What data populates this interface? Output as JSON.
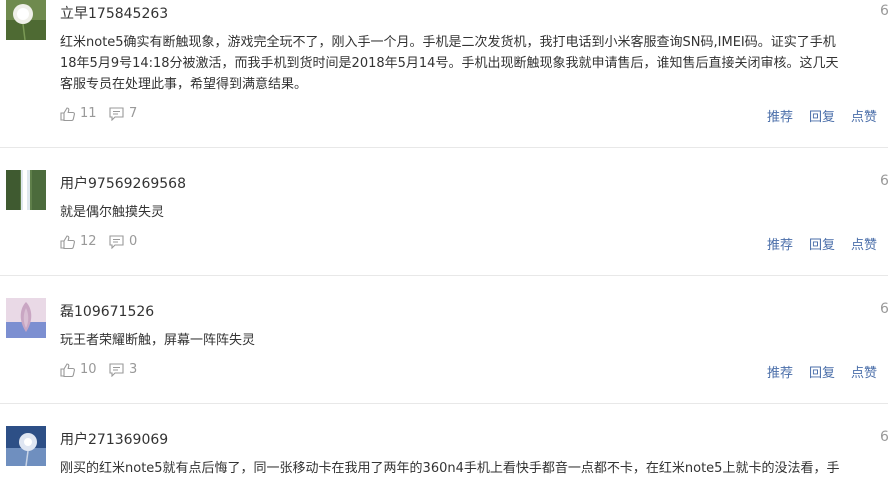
{
  "comments": [
    {
      "username": "立早175845263",
      "time": "6",
      "lines": [
        "红米note5确实有断触现象，游戏完全玩不了，刚入手一个月。手机是二次发货机，我打电话到小米客服查询SN码,IMEI码。证实了手机",
        "18年5月9号14:18分被激活，而我手机到货时间是2018年5月14号。手机出现断触现象我就申请售后，谁知售后直接关闭审核。这几天",
        "客服专员在处理此事，希望得到满意结果。"
      ],
      "likes": "11",
      "replies": "7",
      "avatar": "dandelion"
    },
    {
      "username": "用户97569269568",
      "time": "6",
      "lines": [
        "就是偶尔触摸失灵"
      ],
      "likes": "12",
      "replies": "0",
      "avatar": "waterfall"
    },
    {
      "username": "磊109671526",
      "time": "6",
      "lines": [
        "玩王者荣耀断触，屏幕一阵阵失灵"
      ],
      "likes": "10",
      "replies": "3",
      "avatar": "purple-plant"
    },
    {
      "username": "用户271369069",
      "time": "6",
      "lines": [
        "刚买的红米note5就有点后悔了，同一张移动卡在我用了两年的360n4手机上看快手都音一点都不卡，在红米note5上就卡的没法看，手"
      ],
      "likes": "",
      "replies": "",
      "avatar": "dandelion-blue"
    }
  ],
  "actions": {
    "recommend": "推荐",
    "reply": "回复",
    "like": "点赞"
  },
  "colors": {
    "link": "#4a6ea9",
    "muted": "#999999",
    "text": "#333333",
    "divider": "#e8e8e8"
  }
}
